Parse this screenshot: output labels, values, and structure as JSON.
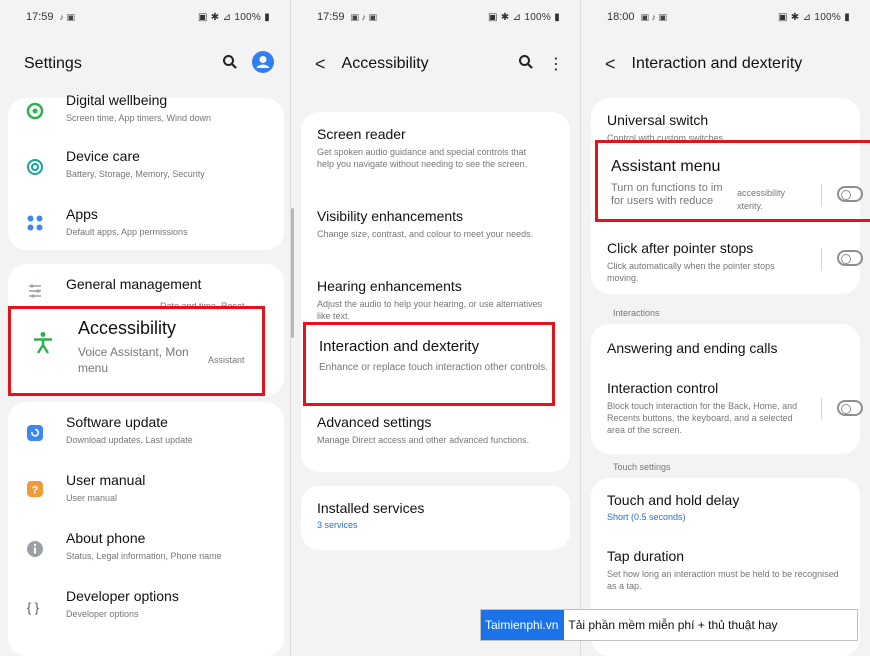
{
  "panel1": {
    "status": {
      "time": "17:59",
      "right": "100%"
    },
    "title": "Settings",
    "items_top": [
      {
        "title": "Digital wellbeing",
        "subtitle": "Screen time, App timers, Wind down"
      },
      {
        "title": "Device care",
        "subtitle": "Battery, Storage, Memory, Security"
      },
      {
        "title": "Apps",
        "subtitle": "Default apps, App permissions"
      }
    ],
    "general": {
      "title": "General management",
      "subtitle": "Date and time, Reset"
    },
    "accessibility": {
      "title": "Accessibility",
      "subtitle_1": "Voice Assistant, Mon",
      "subtitle_2": "Assistant",
      "subtitle_3": "menu"
    },
    "items_bottom": [
      {
        "title": "Software update",
        "subtitle": "Download updates, Last update"
      },
      {
        "title": "User manual",
        "subtitle": "User manual"
      },
      {
        "title": "About phone",
        "subtitle": "Status, Legal information, Phone name"
      },
      {
        "title": "Developer options",
        "subtitle": "Developer options"
      }
    ]
  },
  "panel2": {
    "status": {
      "time": "17:59",
      "right": "100%"
    },
    "title": "Accessibility",
    "items": [
      {
        "title": "Screen reader",
        "subtitle": "Get spoken audio guidance and special controls that help you navigate without needing to see the screen."
      },
      {
        "title": "Visibility enhancements",
        "subtitle": "Change size, contrast, and colour to meet your needs."
      },
      {
        "title": "Hearing enhancements",
        "subtitle": "Adjust the audio to help your hearing, or use alternatives like text."
      },
      {
        "title": "Interaction and dexterity",
        "subtitle": "Enhance or replace touch interaction other controls."
      },
      {
        "title": "Advanced settings",
        "subtitle": "Manage Direct access and other advanced functions."
      }
    ],
    "installed": {
      "title": "Installed services",
      "subtitle": "3 services"
    }
  },
  "panel3": {
    "status": {
      "time": "18:00",
      "right": "100%"
    },
    "title": "Interaction and dexterity",
    "universal": {
      "title": "Universal switch",
      "subtitle": "Control with custom switches."
    },
    "assistant": {
      "title": "Assistant menu",
      "subtitle_1": "Turn on functions to im",
      "subtitle_2": "for users with reduce",
      "subtitle_3": "accessibility",
      "subtitle_4": "xterity."
    },
    "click_after": {
      "title": "Click after pointer stops",
      "subtitle": "Click automatically when the pointer stops moving."
    },
    "section_interactions": "Interactions",
    "answering": {
      "title": "Answering and ending calls"
    },
    "interaction_control": {
      "title": "Interaction control",
      "subtitle": "Block touch interaction for the Back, Home, and Recents buttons, the keyboard, and a selected area of the screen."
    },
    "section_touch": "Touch settings",
    "touch_hold": {
      "title": "Touch and hold delay",
      "subtitle": "Short (0.5 seconds)"
    },
    "tap_duration": {
      "title": "Tap duration",
      "subtitle": "Set how long an interaction must be held to be recognised as a tap."
    }
  },
  "banner": {
    "brand": "Taimienphi.vn",
    "slogan": "Tải phần mềm miễn phí + thủ thuật hay"
  },
  "colors": {
    "accent_blue": "#2a6fd6",
    "highlight_red": "#e1141b",
    "accessibility_green": "#2bb24c"
  }
}
